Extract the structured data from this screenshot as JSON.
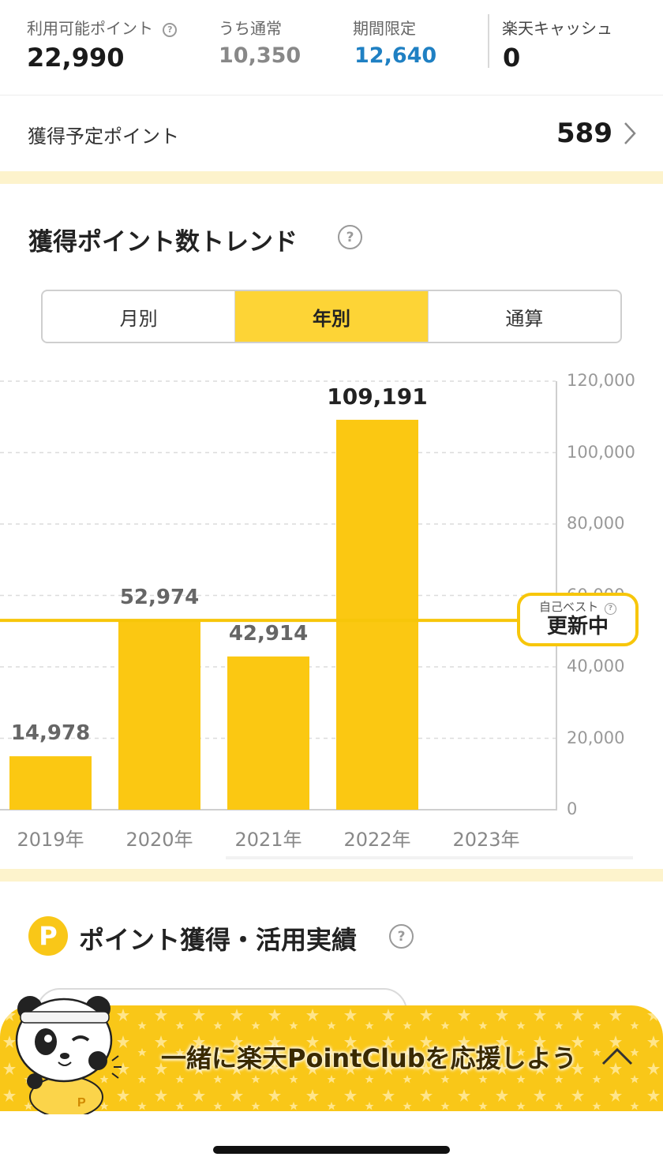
{
  "points": {
    "available_label": "利用可能ポイント",
    "available_value": "22,990",
    "regular_label": "うち通常",
    "regular_value": "10,350",
    "limited_label": "期間限定",
    "limited_value": "12,640",
    "cash_label": "楽天キャッシュ",
    "cash_value": "0"
  },
  "scheduled": {
    "label": "獲得予定ポイント",
    "value": "589"
  },
  "trend": {
    "title": "獲得ポイント数トレンド",
    "help_icon": "?",
    "tabs": [
      {
        "label": "月別",
        "active": false
      },
      {
        "label": "年別",
        "active": true
      },
      {
        "label": "通算",
        "active": false
      }
    ],
    "best_label": "自己ベスト",
    "best_status": "更新中"
  },
  "chart_data": {
    "type": "bar",
    "categories": [
      "2019年",
      "2020年",
      "2021年",
      "2022年",
      "2023年"
    ],
    "values": [
      14978,
      52974,
      42914,
      109191,
      null
    ],
    "value_labels": [
      "14,978",
      "52,974",
      "42,914",
      "109,191",
      ""
    ],
    "y_ticks": [
      "0",
      "20,000",
      "40,000",
      "60,000",
      "80,000",
      "100,000",
      "120,000"
    ],
    "ylim": [
      0,
      120000
    ],
    "reference_line": 53000,
    "bar_color": "#fbc812",
    "grid": true
  },
  "history": {
    "title": "ポイント獲得・活用実績",
    "badge": "P"
  },
  "banner": {
    "text": "一緒に楽天PointClubを応援しよう"
  },
  "colors": {
    "accent": "#fdd436",
    "limited": "#1f80c3",
    "band": "#fdf3cc"
  }
}
